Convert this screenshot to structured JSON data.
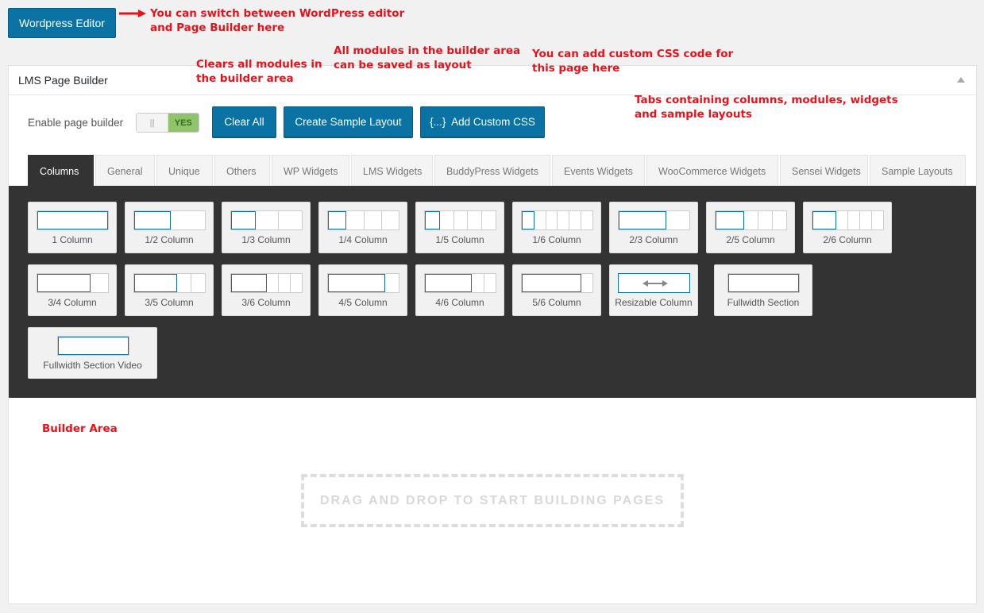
{
  "header": {
    "wp_editor_label": "Wordpress Editor"
  },
  "annotations": {
    "switch_1": "You can switch between WordPress editor",
    "switch_2": "and Page Builder here",
    "clears_1": "Clears all modules in",
    "clears_2": "the builder area",
    "saved_1": "All modules in the builder area",
    "saved_2": "can be saved as layout",
    "css_1": "You can add custom CSS code for",
    "css_2": "this page here",
    "tabs_1": "Tabs containing columns, modules, widgets",
    "tabs_2": "and sample layouts",
    "builder_area": "Builder Area"
  },
  "panel": {
    "title": "LMS Page Builder",
    "enable_label": "Enable page builder",
    "toggle_knob": "|||",
    "toggle_value": "YES",
    "buttons": {
      "clear_all": "Clear All",
      "create_sample": "Create Sample Layout",
      "custom_css": "{...}  Add Custom CSS"
    }
  },
  "tabs": [
    "Columns",
    "General",
    "Unique",
    "Others",
    "WP Widgets",
    "LMS Widgets",
    "BuddyPress Widgets",
    "Events Widgets",
    "WooCommerce Widgets",
    "Sensei Widgets",
    "Sample Layouts"
  ],
  "columns": [
    "1 Column",
    "1/2 Column",
    "1/3 Column",
    "1/4 Column",
    "1/5 Column",
    "1/6 Column",
    "2/3 Column",
    "2/5 Column",
    "2/6 Column",
    "3/4 Column",
    "3/5 Column",
    "3/6 Column",
    "4/5 Column",
    "4/6 Column",
    "5/6 Column",
    "Resizable Column",
    "Fullwidth Section",
    "Fullwidth Section Video"
  ],
  "builder": {
    "drop_text": "DRAG AND DROP TO START BUILDING PAGES"
  },
  "colors": {
    "accent": "#0a73a3",
    "annotation": "#e8121b",
    "toggle_on": "#8fc46a",
    "dark_bg": "#333333"
  }
}
